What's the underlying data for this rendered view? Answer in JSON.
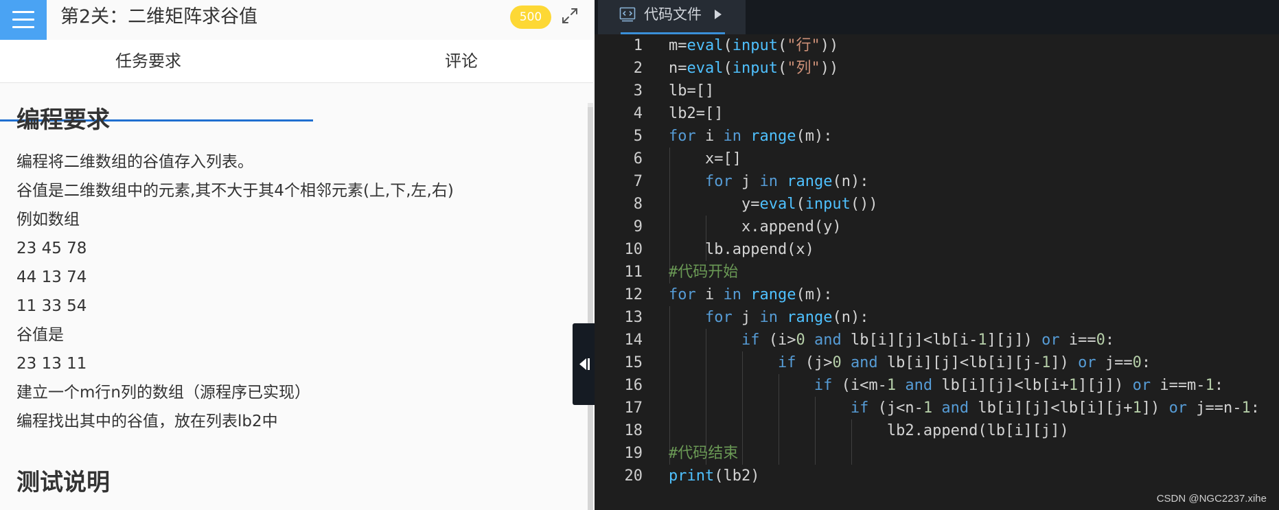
{
  "header": {
    "title": "第2关：二维矩阵求谷值",
    "score": "500"
  },
  "tabs": [
    {
      "label": "任务要求",
      "active": true
    },
    {
      "label": "评论",
      "active": false
    }
  ],
  "content": {
    "section1_title": "编程要求",
    "lines": [
      "编程将二维数组的谷值存入列表。",
      "谷值是二维数组中的元素,其不大于其4个相邻元素(上,下,左,右)",
      "例如数组",
      "23  45  78",
      "44  13  74",
      "11  33  54",
      "谷值是",
      "23   13   11",
      "建立一个m行n列的数组（源程序已实现）",
      "编程找出其中的谷值，放在列表lb2中"
    ],
    "section2_title": "测试说明"
  },
  "editor": {
    "file_tab_label": "代码文件",
    "line_numbers": [
      "1",
      "2",
      "3",
      "4",
      "5",
      "6",
      "7",
      "8",
      "9",
      "10",
      "11",
      "12",
      "13",
      "14",
      "15",
      "16",
      "17",
      "18",
      "19",
      "20"
    ]
  },
  "watermark": "CSDN @NGC2237.xihe",
  "colors": {
    "menu_button": "#4aa3f3",
    "score_badge": "#fdd835",
    "active_tab_underline": "#1f6fd0",
    "editor_bg": "#1e1e1e",
    "keyword": "#569cd6",
    "string": "#ce9178",
    "comment": "#6a9955"
  }
}
